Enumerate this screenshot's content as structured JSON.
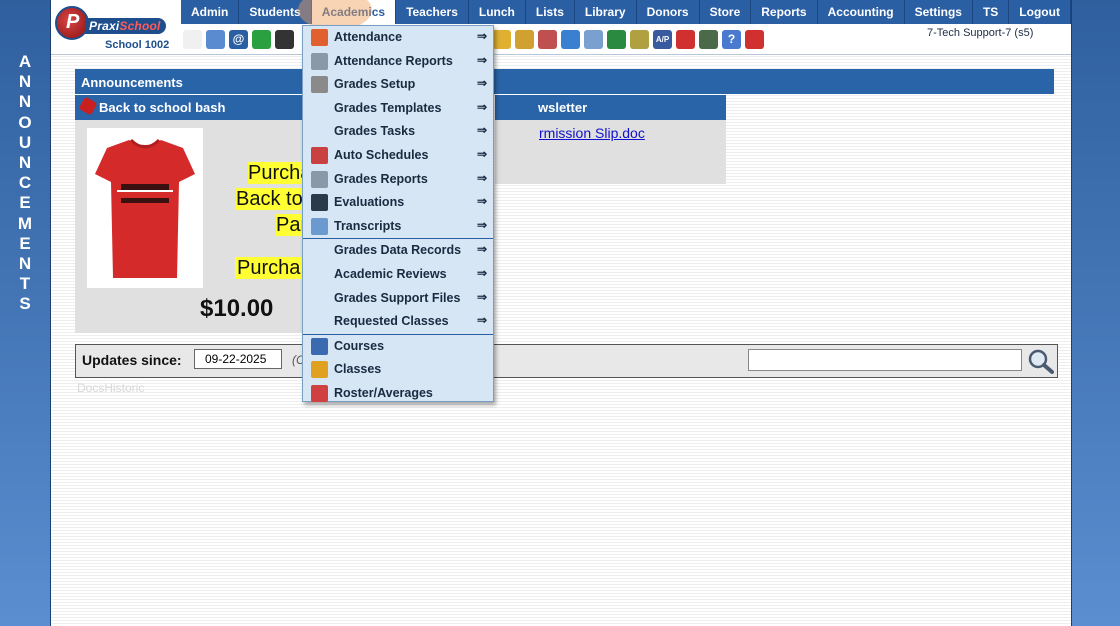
{
  "side_label": "ANNOUNCEMENTS",
  "logo": {
    "brand_main": "Praxi",
    "brand_accent": "School",
    "school": "School 1002"
  },
  "nav": [
    "Admin",
    "Students",
    "Academics",
    "Teachers",
    "Lunch",
    "Lists",
    "Library",
    "Donors",
    "Store",
    "Reports",
    "Accounting",
    "Settings",
    "TS",
    "Logout"
  ],
  "nav_active": "Academics",
  "user_label": "7-Tech Support-7 (s5)",
  "announcements": {
    "title": "Announcements",
    "item1": {
      "title": "Back to school bash",
      "promo_line1": "Purcha",
      "promo_line2": "Back to",
      "promo_line3": "Par",
      "price": "$10.00"
    },
    "item2": {
      "title": "wsletter",
      "link": "rmission Slip.doc"
    }
  },
  "updates": {
    "label": "Updates since:",
    "date": "09-22-2025",
    "paren": "(C",
    "search_placeholder": ""
  },
  "ghost_text": "DocsHistoric",
  "dropdown": {
    "items": [
      {
        "label": "Attendance",
        "arrow": "⇒",
        "icon": "calendar-icon",
        "color": "#e06030"
      },
      {
        "label": "Attendance Reports",
        "arrow": "⇒",
        "icon": "printer-icon",
        "color": "#8a98a8"
      },
      {
        "label": "Grades Setup",
        "arrow": "⇒",
        "icon": "gear-icon",
        "color": "#8a8a8a"
      },
      {
        "label": "Grades Templates",
        "arrow": "⇒",
        "icon": "",
        "color": ""
      },
      {
        "label": "Grades Tasks",
        "arrow": "⇒",
        "icon": "",
        "color": ""
      },
      {
        "label": "Auto Schedules",
        "arrow": "⇒",
        "icon": "calendar-clock-icon",
        "color": "#c84040"
      },
      {
        "label": "Grades Reports",
        "arrow": "⇒",
        "icon": "printer-icon",
        "color": "#8a98a8"
      },
      {
        "label": "Evaluations",
        "arrow": "⇒",
        "icon": "checkbox-icon",
        "color": "#2a3a4a"
      },
      {
        "label": "Transcripts",
        "arrow": "⇒",
        "icon": "scroll-icon",
        "color": "#6a9ad0"
      },
      {
        "label": "Grades Data Records",
        "arrow": "⇒",
        "icon": "",
        "color": ""
      },
      {
        "label": "Academic Reviews",
        "arrow": "⇒",
        "icon": "",
        "color": ""
      },
      {
        "label": "Grades Support Files",
        "arrow": "⇒",
        "icon": "",
        "color": ""
      },
      {
        "label": "Requested Classes",
        "arrow": "⇒",
        "icon": "",
        "color": ""
      },
      {
        "label": "Courses",
        "arrow": "",
        "icon": "book-icon",
        "color": "#3a6ab0"
      },
      {
        "label": "Classes",
        "arrow": "",
        "icon": "people-icon",
        "color": "#e0a020"
      },
      {
        "label": "Roster/Averages",
        "arrow": "",
        "icon": "roster-icon",
        "color": "#d04040"
      }
    ]
  },
  "colors": {
    "nav_bg": "#2a5fa4",
    "panel_header": "#2a64a8",
    "dropdown_bg": "#d6e6f5",
    "price_highlight": "#ffff33"
  }
}
